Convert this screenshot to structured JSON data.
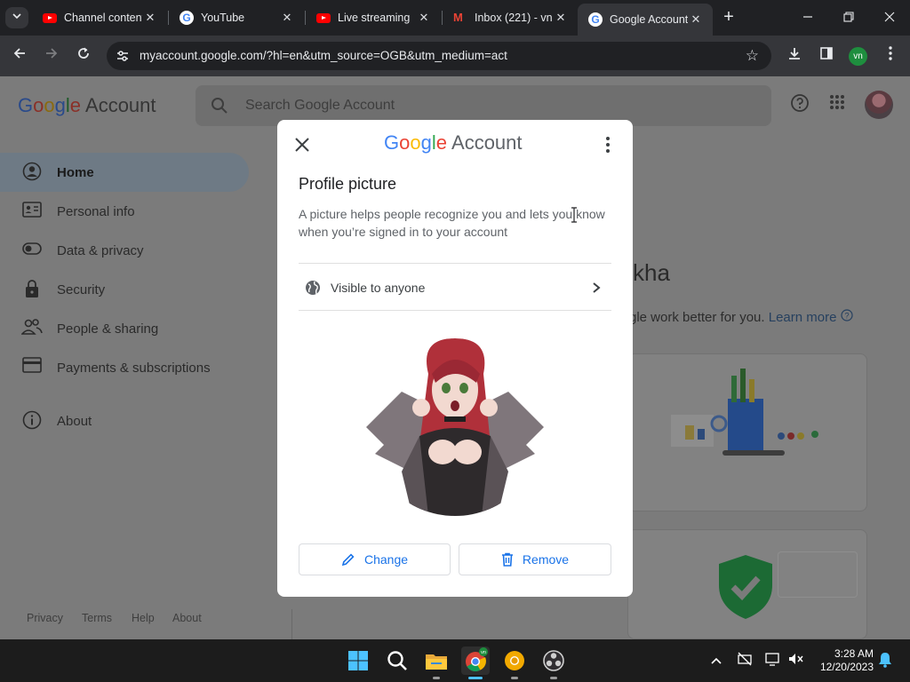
{
  "browser": {
    "tabs": [
      {
        "title": "Channel content",
        "favicon": "youtube-icon"
      },
      {
        "title": "YouTube",
        "favicon": "google-icon"
      },
      {
        "title": "Live streaming",
        "favicon": "youtube-icon"
      },
      {
        "title": "Inbox (221) - vn",
        "favicon": "gmail-icon"
      },
      {
        "title": "Google Account",
        "favicon": "google-icon",
        "active": true
      }
    ],
    "close_glyph": "✕",
    "new_tab_glyph": "+",
    "url": "myaccount.google.com/?hl=en&utm_source=OGB&utm_medium=act",
    "profile_initials": "vn"
  },
  "page": {
    "logo_letters": [
      "G",
      "o",
      "o",
      "g",
      "l",
      "e"
    ],
    "logo_suffix": "Account",
    "search_placeholder": "Search Google Account",
    "nav": [
      {
        "label": "Home",
        "icon": "person-circle-icon",
        "active": true
      },
      {
        "label": "Personal info",
        "icon": "id-card-icon"
      },
      {
        "label": "Data & privacy",
        "icon": "toggle-icon"
      },
      {
        "label": "Security",
        "icon": "lock-icon"
      },
      {
        "label": "People & sharing",
        "icon": "people-icon"
      },
      {
        "label": "Payments & subscriptions",
        "icon": "credit-card-icon"
      },
      {
        "label": "About",
        "icon": "info-icon"
      }
    ],
    "footer": [
      "Privacy",
      "Terms",
      "Help",
      "About"
    ],
    "bg_name_fragment": "kha",
    "bg_text_fragment": "gle work better for you.",
    "bg_learn_more": "Learn more"
  },
  "dialog": {
    "logo_suffix": "Account",
    "title": "Profile picture",
    "description": "A picture helps people recognize you and lets you know when you’re signed in to your account",
    "visibility": "Visible to anyone",
    "change_label": "Change",
    "remove_label": "Remove"
  },
  "taskbar": {
    "apps": [
      "windows-start-icon",
      "search-icon",
      "file-explorer-icon",
      "chrome-icon",
      "chrome-canary-icon",
      "obs-icon"
    ],
    "time": "3:28 AM",
    "date": "12/20/2023"
  },
  "colors": {
    "accent": "#1a73e8",
    "google_blue": "#4285f4",
    "google_red": "#ea4335",
    "google_yellow": "#fbbc05",
    "google_green": "#34a853",
    "chrome_dark": "#202124"
  }
}
